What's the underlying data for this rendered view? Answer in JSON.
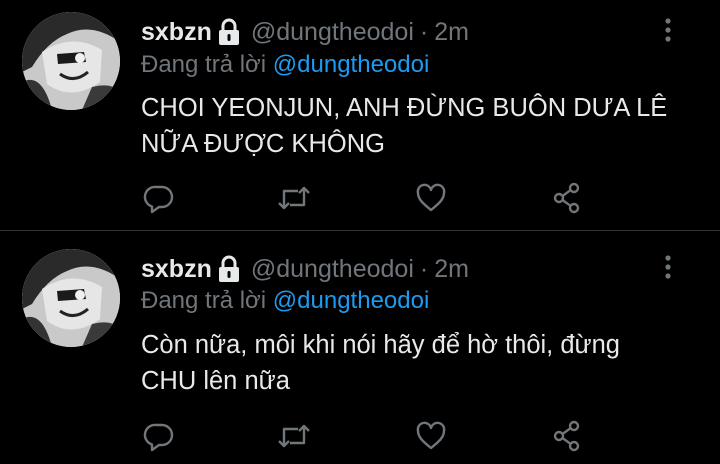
{
  "colors": {
    "background": "#000000",
    "text_primary": "#e7e9ea",
    "text_secondary": "#71767b",
    "mention": "#1d9bf0",
    "divider": "#2f3336"
  },
  "tweets": [
    {
      "display_name": "sxbzn",
      "handle": "@dungtheodoi",
      "separator": "·",
      "time": "2m",
      "reply_prefix": "Đang trả lời",
      "reply_to": "@dungtheodoi",
      "text": "CHOI YEONJUN, ANH ĐỪNG BUÔN DƯA LÊ NỮA ĐƯỢC KHÔNG",
      "icons": [
        "lock-icon",
        "more-vertical-icon",
        "reply-icon",
        "retweet-icon",
        "like-icon",
        "share-icon"
      ]
    },
    {
      "display_name": "sxbzn",
      "handle": "@dungtheodoi",
      "separator": "·",
      "time": "2m",
      "reply_prefix": "Đang trả lời",
      "reply_to": "@dungtheodoi",
      "text": "Còn nữa, môi khi nói hãy để hờ thôi, đừng CHU lên nữa",
      "icons": [
        "lock-icon",
        "more-vertical-icon",
        "reply-icon",
        "retweet-icon",
        "like-icon",
        "share-icon"
      ]
    }
  ]
}
